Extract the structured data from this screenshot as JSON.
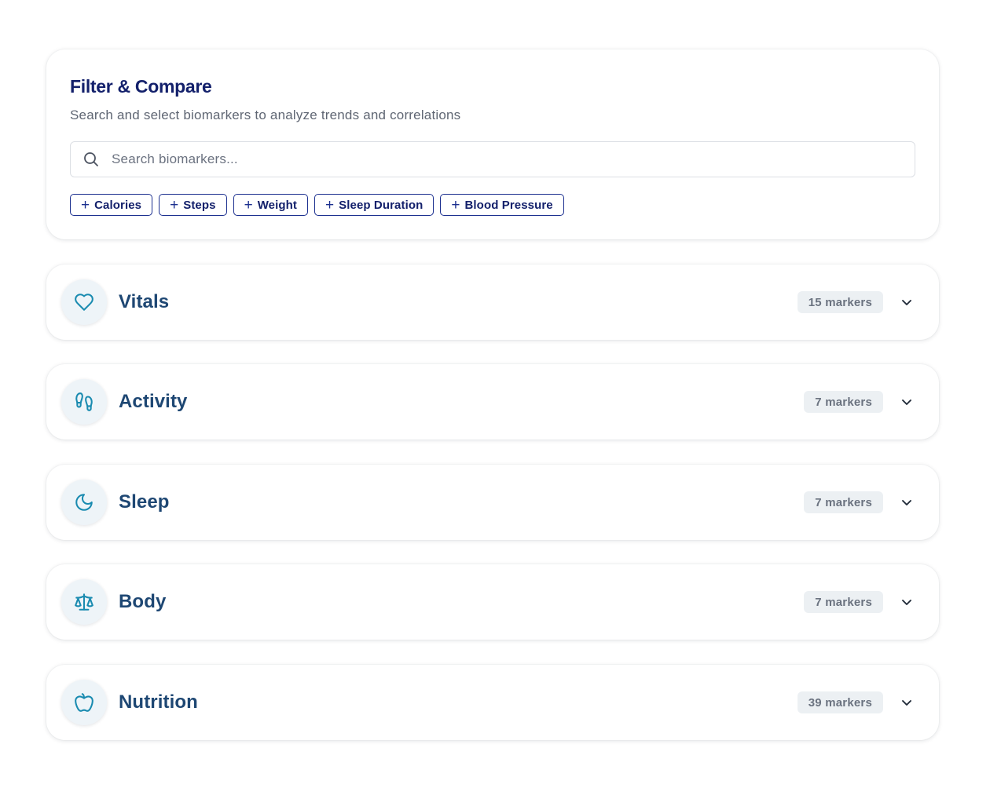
{
  "filter": {
    "title": "Filter & Compare",
    "subtitle": "Search and select biomarkers to analyze trends and correlations",
    "search_placeholder": "Search biomarkers...",
    "quick_add": [
      {
        "icon": "plus",
        "label": "Calories"
      },
      {
        "icon": "plus",
        "label": "Steps"
      },
      {
        "icon": "plus",
        "label": "Weight"
      },
      {
        "icon": "plus",
        "label": "Sleep Duration"
      },
      {
        "icon": "plus",
        "label": "Blood Pressure"
      }
    ]
  },
  "categories": [
    {
      "name": "Vitals",
      "icon": "heart-icon",
      "badge": "15 markers",
      "expanded": false
    },
    {
      "name": "Activity",
      "icon": "footprints-icon",
      "badge": "7 markers",
      "expanded": false
    },
    {
      "name": "Sleep",
      "icon": "moon-icon",
      "badge": "7 markers",
      "expanded": false
    },
    {
      "name": "Body",
      "icon": "scale-icon",
      "badge": "7 markers",
      "expanded": false
    },
    {
      "name": "Nutrition",
      "icon": "apple-icon",
      "badge": "39 markers",
      "expanded": false
    }
  ],
  "colors": {
    "title": "#13206b",
    "chip_border": "#1b2f8f",
    "category_text": "#1e4773",
    "icon_accent": "#1a8bb0",
    "badge_bg": "#ecf0f3",
    "badge_text": "#6b7380"
  }
}
